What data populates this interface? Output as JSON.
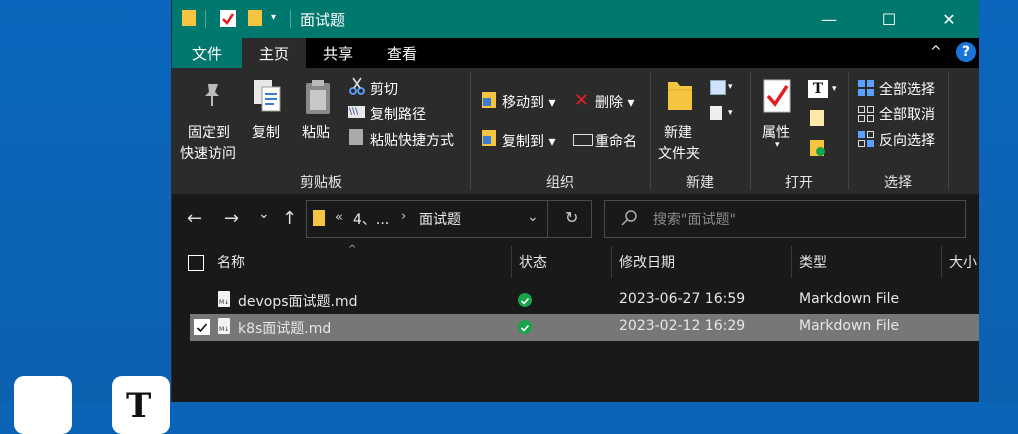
{
  "window": {
    "title": "面试题",
    "controls": {
      "minimize": "—",
      "maximize": "☐",
      "close": "✕"
    }
  },
  "menu": {
    "tabs": [
      "文件",
      "主页",
      "共享",
      "查看"
    ],
    "collapse_icon": "^",
    "help_icon": "?"
  },
  "ribbon": {
    "clipboard": {
      "pin_label_1": "固定到",
      "pin_label_2": "快速访问",
      "copy": "复制",
      "paste": "粘贴",
      "cut": "剪切",
      "copy_path": "复制路径",
      "paste_shortcut": "粘贴快捷方式",
      "group_label": "剪贴板"
    },
    "organize": {
      "move_to": "移动到",
      "copy_to": "复制到",
      "delete": "删除",
      "rename": "重命名",
      "group_label": "组织"
    },
    "new": {
      "folder_1": "新建",
      "folder_2": "文件夹",
      "group_label": "新建"
    },
    "open": {
      "properties": "属性",
      "group_label": "打开"
    },
    "select": {
      "select_all": "全部选择",
      "select_none": "全部取消",
      "invert": "反向选择",
      "group_label": "选择"
    }
  },
  "nav": {
    "back": "←",
    "forward": "→",
    "recent": "⌄",
    "up": "↑",
    "address_sep": "«",
    "address_parts": [
      "4、...",
      "面试题"
    ],
    "refresh": "↻",
    "search_placeholder": "搜索\"面试题\""
  },
  "table": {
    "columns": [
      "名称",
      "状态",
      "修改日期",
      "类型",
      "大小"
    ],
    "rows": [
      {
        "name": "devops面试题.md",
        "date": "2023-06-27 16:59",
        "type": "Markdown File",
        "selected": false
      },
      {
        "name": "k8s面试题.md",
        "date": "2023-02-12 16:29",
        "type": "Markdown File",
        "selected": true
      }
    ]
  },
  "colors": {
    "accent": "#00786e",
    "ribbon_bg": "#2b2b2b",
    "window_bg": "#191919",
    "desktop": "#0b64b8",
    "selected_row": "#777777",
    "status_ok": "#16a34a"
  }
}
